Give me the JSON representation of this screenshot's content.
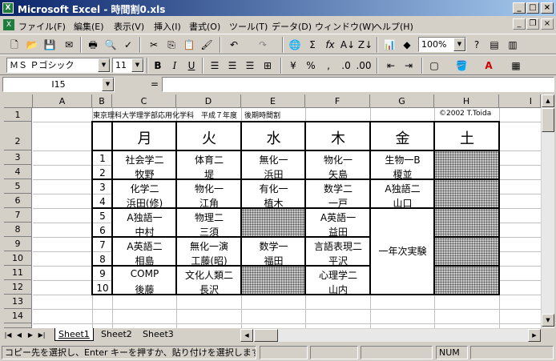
{
  "window": {
    "title": "Microsoft Excel - 時間割0.xls",
    "excel_icon": "X"
  },
  "menu": [
    "ファイル(F)",
    "編集(E)",
    "表示(V)",
    "挿入(I)",
    "書式(O)",
    "ツール(T)",
    "データ(D)",
    "ウィンドウ(W)",
    "ヘルプ(H)"
  ],
  "toolbar": {
    "zoom": "100%",
    "font": "ＭＳ Ｐゴシック",
    "size": "11",
    "bold": "B",
    "italic": "I",
    "underline": "U",
    "sum": "Σ",
    "fx": "fx",
    "percent": "%",
    "comma": ","
  },
  "formula": {
    "namebox": "I15",
    "equals": "=",
    "content": ""
  },
  "columns": [
    "A",
    "B",
    "C",
    "D",
    "E",
    "F",
    "G",
    "H",
    "I"
  ],
  "rows": [
    "1",
    "2",
    "3",
    "4",
    "5",
    "6",
    "7",
    "8",
    "9",
    "10",
    "11",
    "12",
    "13",
    "14"
  ],
  "sheet": {
    "title": "東京理科大学理学部応用化学科　平成７年度　後期時間割",
    "copyright": "©2002 T.Toida",
    "days": [
      "月",
      "火",
      "水",
      "木",
      "金",
      "土"
    ],
    "periods": [
      "1",
      "2",
      "3",
      "4",
      "5",
      "6",
      "7",
      "8",
      "9",
      "10"
    ],
    "mon": [
      "社会学二",
      "牧野",
      "化学二",
      "浜田(修)",
      "A独語一",
      "中村",
      "A英語二",
      "相島",
      "COMP",
      "後藤"
    ],
    "tue": [
      "体育二",
      "堤",
      "物化一",
      "江角",
      "物理二",
      "三須",
      "無化一演",
      "工藤(昭)",
      "文化人類二",
      "長沢"
    ],
    "wed": [
      "無化一",
      "浜田",
      "有化一",
      "植木",
      "",
      "",
      "数学一",
      "福田",
      "",
      ""
    ],
    "thu": [
      "物化一",
      "矢島",
      "数学二",
      "一戸",
      "A英語一",
      "益田",
      "言語表現二",
      "平沢",
      "心理学二",
      "山内"
    ],
    "fri": [
      "生物一B",
      "榎並",
      "A独語二",
      "山口",
      "一年次実験"
    ]
  },
  "tabs": [
    "Sheet1",
    "Sheet2",
    "Sheet3"
  ],
  "status": {
    "message": "コピー先を選択し、Enter キーを押すか、貼り付けを選択します",
    "num": "NUM"
  }
}
